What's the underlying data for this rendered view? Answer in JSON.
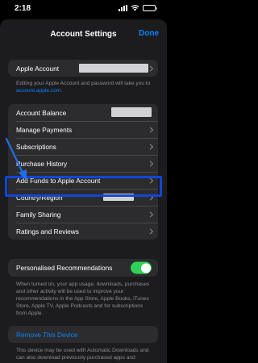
{
  "status": {
    "time": "2:18"
  },
  "nav": {
    "title": "Account Settings",
    "done": "Done"
  },
  "apple_account": {
    "label": "Apple Account",
    "note_text": "Editing your Apple Account and password will take you to ",
    "note_link": "account.apple.com",
    "note_end": "."
  },
  "rows": {
    "account_balance": "Account Balance",
    "manage_payments": "Manage Payments",
    "subscriptions": "Subscriptions",
    "purchase_history": "Purchase History",
    "add_funds": "Add Funds to Apple Account",
    "country_region": "Country/Region",
    "family_sharing": "Family Sharing",
    "ratings_reviews": "Ratings and Reviews"
  },
  "personalised": {
    "label": "Personalised Recommendations",
    "enabled": true,
    "note": "When turned on, your app usage, downloads, purchases and other activity will be used to improve your recommendations in the App Store, Apple Books, iTunes Store, Apple TV, Apple Podcasts and for subscriptions from Apple."
  },
  "remove_device": {
    "label": "Remove This Device",
    "note": "This device may be used with Automatic Downloads and can also download previously purchased apps and"
  },
  "colors": {
    "accent": "#0a84ff",
    "toggle_on": "#30d158",
    "highlight": "#1246d6"
  },
  "icons": [
    "chevron-right-icon",
    "annotation-arrow-icon"
  ]
}
